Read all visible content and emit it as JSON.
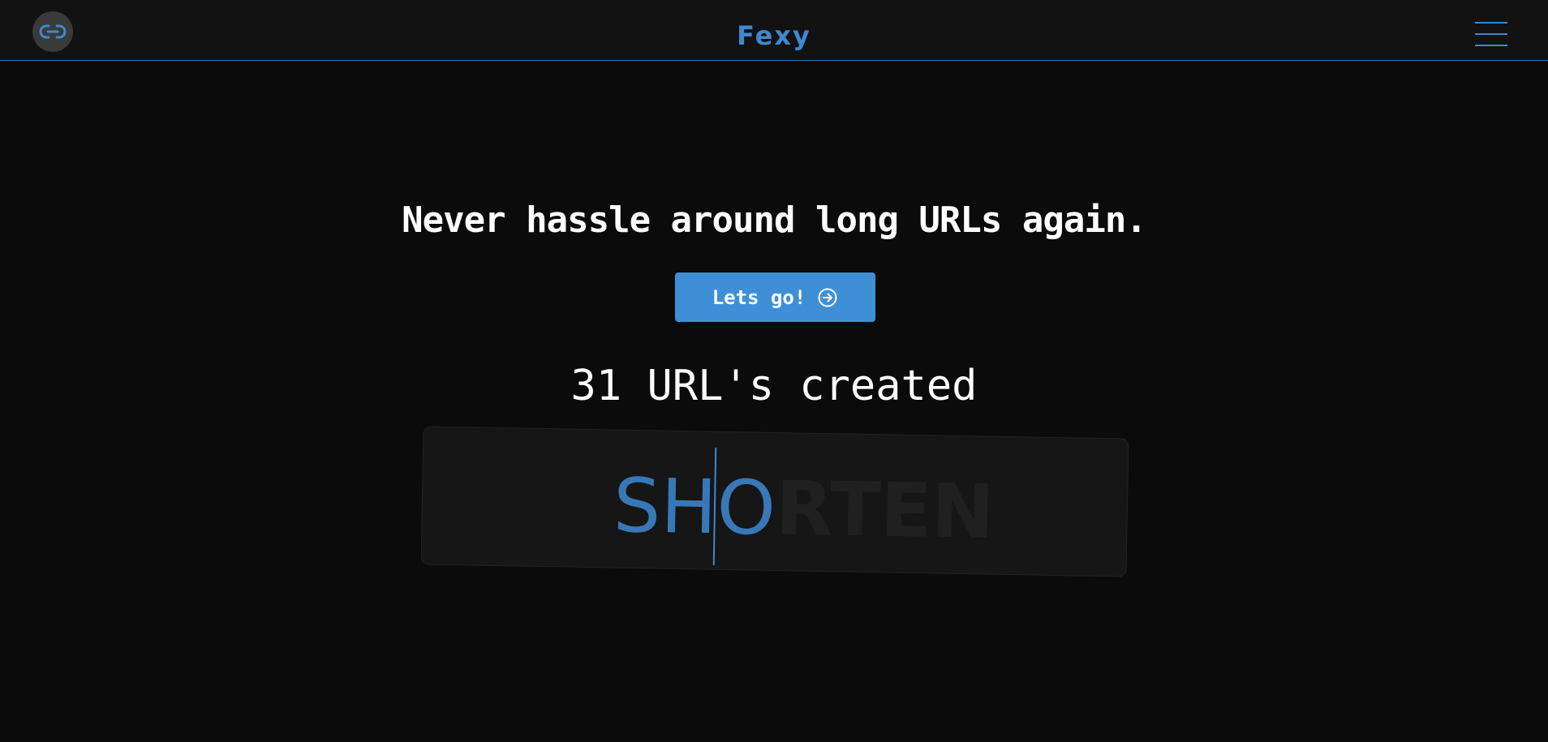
{
  "navbar": {
    "logo_icon": "link-icon",
    "brand": "Fexy",
    "menu_icon": "hamburger-menu-icon"
  },
  "hero": {
    "headline": "Never hassle around long URLs again.",
    "cta_label": "Lets go!",
    "cta_icon": "arrow-right-circle-icon",
    "counter": "31 URL's created"
  },
  "typewriter": {
    "typed_text": "SHO",
    "remaining_text": "RTEN"
  },
  "colors": {
    "accent": "#3e8fd6",
    "background": "#0b0b0b",
    "navbar_bg": "#121212"
  }
}
